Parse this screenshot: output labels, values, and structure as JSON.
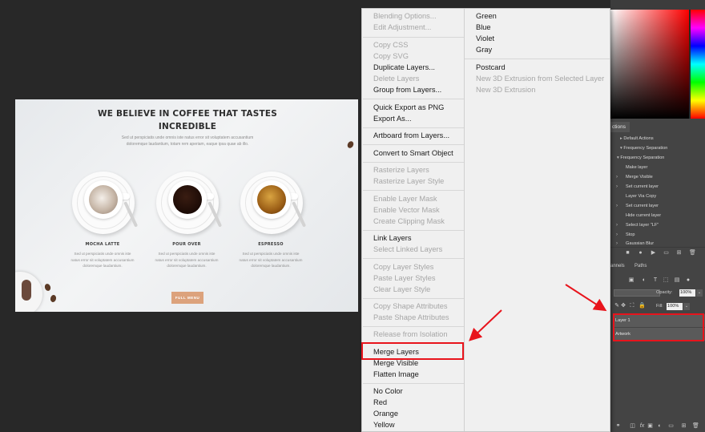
{
  "document": {
    "hero_title_line1": "WE BELIEVE IN COFFEE THAT TASTES",
    "hero_title_line2": "INCREDIBLE",
    "hero_text_line1": "Sed ut perspiciatis unde omnis iste natus error sit voluptatem accusantium",
    "hero_text_line2": "doloremque laudantium, totam rem aperiam, eaque ipsa quae ab illo.",
    "products": [
      {
        "name": "MOCHA LATTE",
        "desc1": "Sed ut perspiciatis unde omnis iste",
        "desc2": "natus error sit voluptatem accusantium",
        "desc3": "doloremque laudantium."
      },
      {
        "name": "POUR OVER",
        "desc1": "Sed ut perspiciatis unde omnis iste",
        "desc2": "natus error sit voluptatem accusantium",
        "desc3": "doloremque laudantium."
      },
      {
        "name": "ESPRESSO",
        "desc1": "Sed ut perspiciatis unde omnis iste",
        "desc2": "natus error sit voluptatem accusantium",
        "desc3": "doloremque laudantium."
      }
    ],
    "button_label": "FULL MENU",
    "accent_color": "#dca27c"
  },
  "context_menu": {
    "left_items": [
      {
        "label": "Blending Options...",
        "disabled": true
      },
      {
        "label": "Edit Adjustment...",
        "disabled": true
      },
      {
        "label": "Copy CSS",
        "disabled": true
      },
      {
        "label": "Copy SVG",
        "disabled": true
      },
      {
        "label": "Duplicate Layers...",
        "disabled": false
      },
      {
        "label": "Delete Layers",
        "disabled": true
      },
      {
        "label": "Group from Layers...",
        "disabled": false
      },
      {
        "label": "Quick Export as PNG",
        "disabled": false
      },
      {
        "label": "Export As...",
        "disabled": false
      },
      {
        "label": "Artboard from Layers...",
        "disabled": false
      },
      {
        "label": "Convert to Smart Object",
        "disabled": false
      },
      {
        "label": "Rasterize Layers",
        "disabled": true
      },
      {
        "label": "Rasterize Layer Style",
        "disabled": true
      },
      {
        "label": "Enable Layer Mask",
        "disabled": true
      },
      {
        "label": "Enable Vector Mask",
        "disabled": true
      },
      {
        "label": "Create Clipping Mask",
        "disabled": true
      },
      {
        "label": "Link Layers",
        "disabled": false
      },
      {
        "label": "Select Linked Layers",
        "disabled": true
      },
      {
        "label": "Copy Layer Styles",
        "disabled": true
      },
      {
        "label": "Paste Layer Styles",
        "disabled": true
      },
      {
        "label": "Clear Layer Style",
        "disabled": true
      },
      {
        "label": "Copy Shape Attributes",
        "disabled": true
      },
      {
        "label": "Paste Shape Attributes",
        "disabled": true
      },
      {
        "label": "Release from Isolation",
        "disabled": true
      },
      {
        "label": "Merge Layers",
        "disabled": false,
        "highlighted": true
      },
      {
        "label": "Merge Visible",
        "disabled": false
      },
      {
        "label": "Flatten Image",
        "disabled": false
      },
      {
        "label": "No Color",
        "disabled": false
      },
      {
        "label": "Red",
        "disabled": false
      },
      {
        "label": "Orange",
        "disabled": false
      },
      {
        "label": "Yellow",
        "disabled": false
      }
    ],
    "right_items": [
      {
        "label": "Green",
        "disabled": false
      },
      {
        "label": "Blue",
        "disabled": false
      },
      {
        "label": "Violet",
        "disabled": false
      },
      {
        "label": "Gray",
        "disabled": false
      },
      {
        "label": "Postcard",
        "disabled": false
      },
      {
        "label": "New 3D Extrusion from Selected Layer",
        "disabled": true
      },
      {
        "label": "New 3D Extrusion",
        "disabled": true
      }
    ]
  },
  "actions_panel": {
    "tab": "ctions",
    "items": [
      {
        "label": "Default Actions"
      },
      {
        "label": "Frequency Separation"
      },
      {
        "label": "Frequency Separation"
      },
      {
        "label": "Make layer"
      },
      {
        "label": "Merge Visible"
      },
      {
        "label": "Set current layer"
      },
      {
        "label": "Layer Via Copy"
      },
      {
        "label": "Set current layer"
      },
      {
        "label": "Hide current layer"
      },
      {
        "label": "Select layer \"LF\""
      },
      {
        "label": "Stop"
      },
      {
        "label": "Gaussian Blur"
      }
    ]
  },
  "layers_panel": {
    "tab_channels": "annels",
    "tab_paths": "Paths",
    "opacity_label": "Opacity:",
    "opacity_value": "100%",
    "fill_label": "Fill:",
    "fill_value": "100%",
    "layers": [
      {
        "name": "Layer 1"
      },
      {
        "name": "Artwork"
      }
    ]
  },
  "annotation_color": "#e8141c"
}
